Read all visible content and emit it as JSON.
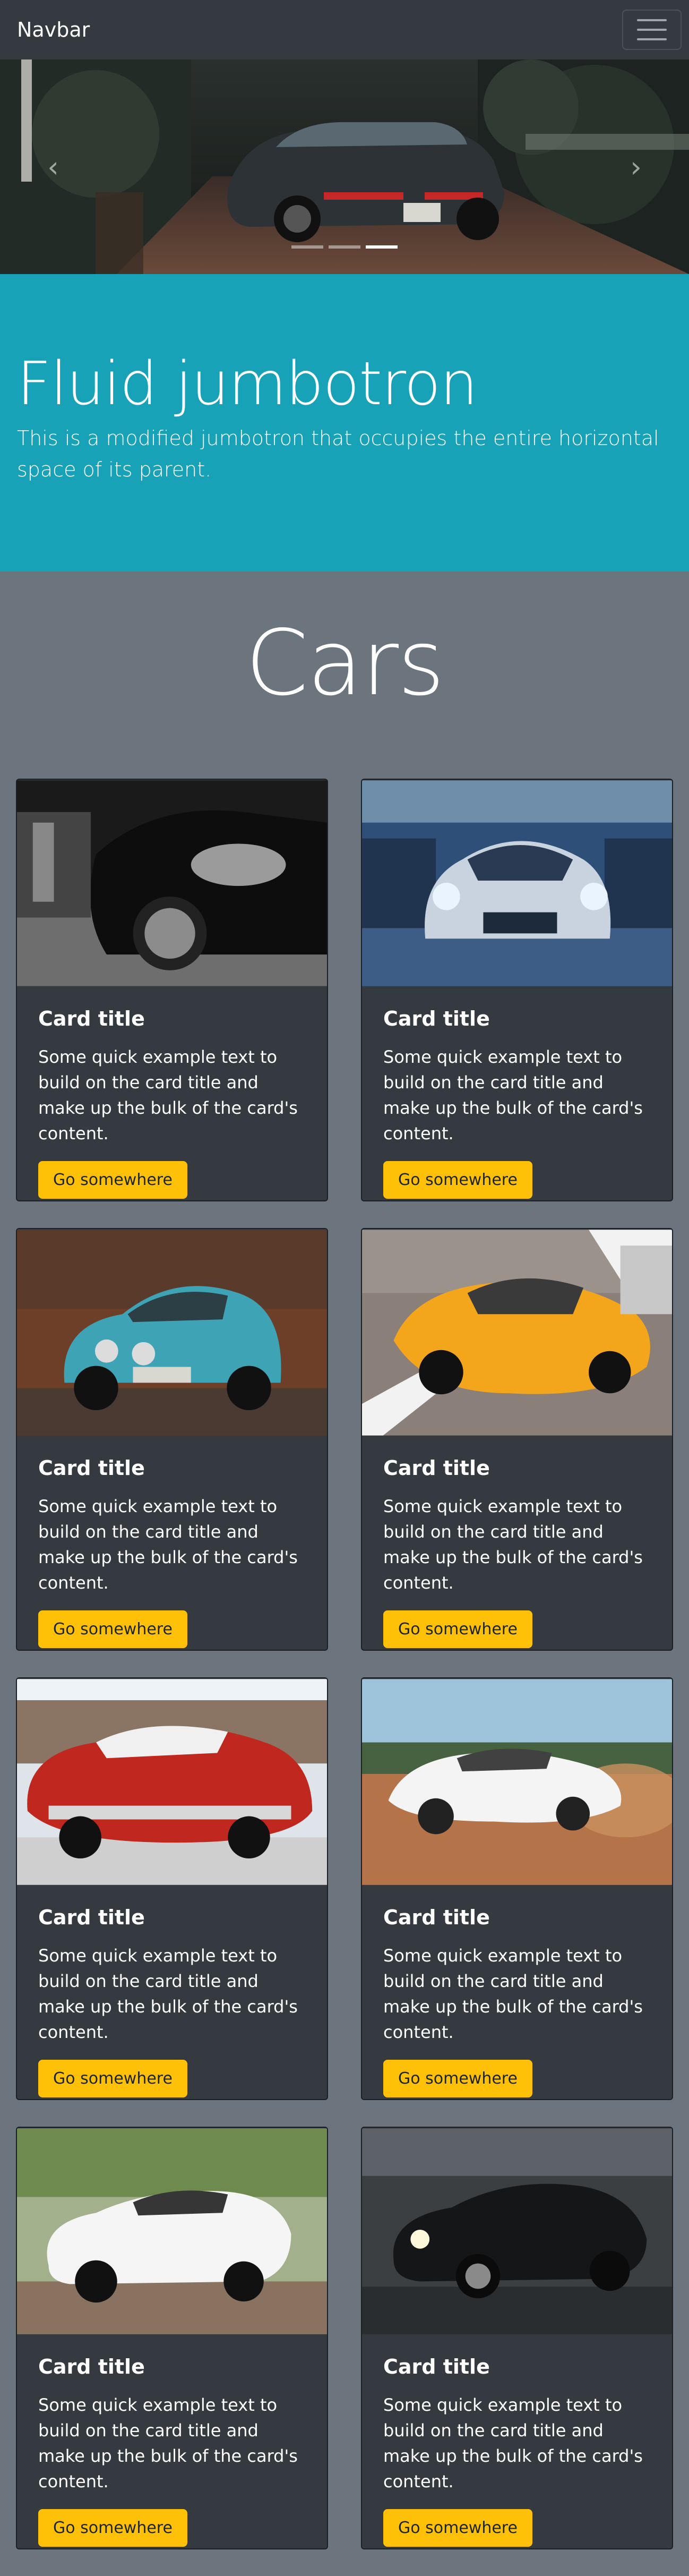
{
  "navbar": {
    "brand": "Navbar",
    "toggler_icon": "hamburger-icon"
  },
  "carousel": {
    "prev_icon": "chevron-left-icon",
    "next_icon": "chevron-right-icon",
    "slide_count": 3,
    "active_slide": 3
  },
  "jumbotron": {
    "title": "Fluid jumbotron",
    "lead": "This is a modified jumbotron that occupies the entire horizontal space of its parent."
  },
  "section": {
    "title": "Cars"
  },
  "cards": [
    {
      "title": "Card title",
      "text": "Some quick example text to build on the card title and make up the bulk of the card's content.",
      "button": "Go somewhere",
      "image": "black-sports-car-photo"
    },
    {
      "title": "Card title",
      "text": "Some quick example text to build on the card title and make up the bulk of the card's content.",
      "button": "Go somewhere",
      "image": "silver-mercedes-photo"
    },
    {
      "title": "Card title",
      "text": "Some quick example text to build on the card title and make up the bulk of the card's content.",
      "button": "Go somewhere",
      "image": "blue-classic-alpine-photo"
    },
    {
      "title": "Card title",
      "text": "Some quick example text to build on the card title and make up the bulk of the card's content.",
      "button": "Go somewhere",
      "image": "yellow-lamborghini-photo"
    },
    {
      "title": "Card title",
      "text": "Some quick example text to build on the card title and make up the bulk of the card's content.",
      "button": "Go somewhere",
      "image": "red-classic-chevrolet-photo"
    },
    {
      "title": "Card title",
      "text": "Some quick example text to build on the card title and make up the bulk of the card's content.",
      "button": "Go somewhere",
      "image": "white-bmw-drifting-photo"
    },
    {
      "title": "Card title",
      "text": "Some quick example text to build on the card title and make up the bulk of the card's content.",
      "button": "Go somewhere",
      "image": "white-supra-photo"
    },
    {
      "title": "Card title",
      "text": "Some quick example text to build on the card title and make up the bulk of the card's content.",
      "button": "Go somewhere",
      "image": "black-bmw-sedan-photo"
    }
  ],
  "colors": {
    "navbar": "#343a40",
    "jumbotron": "#17a2b8",
    "page": "#6c757d",
    "card": "#343a40",
    "button": "#ffc107"
  }
}
